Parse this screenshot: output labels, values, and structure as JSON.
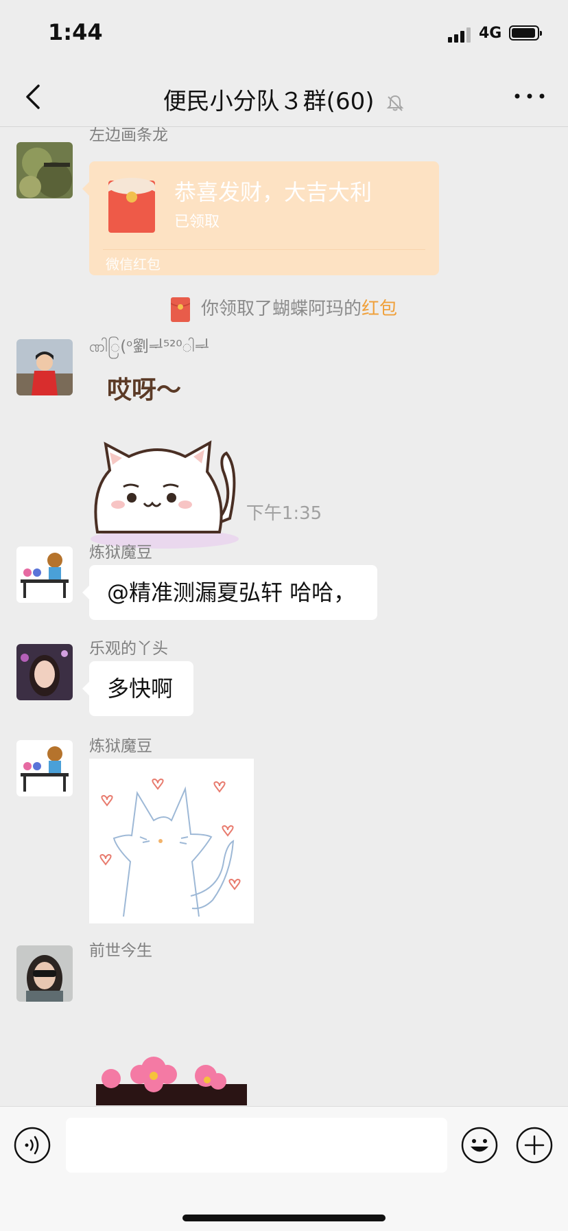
{
  "status_bar": {
    "time": "1:44",
    "network": "4G"
  },
  "nav": {
    "title": "便民小分队３群(60)",
    "back_icon": "chevron-left-icon",
    "mute_icon": "bell-off-icon",
    "more_icon": "more-dots-icon"
  },
  "messages": [
    {
      "sender": "左边画条龙",
      "type": "red_packet",
      "red_packet": {
        "title": "恭喜发财，大吉大利",
        "status": "已领取",
        "footer": "微信红包"
      }
    },
    {
      "type": "system",
      "prefix": "你领取了蝴蝶阿玛的",
      "highlight": "红包"
    },
    {
      "sender": "ဏါြ(ᵒ劉ᆗ⁵²⁰ါᆗ",
      "type": "sticker",
      "sticker_text": "哎呀～"
    },
    {
      "type": "time",
      "text": "下午1:35"
    },
    {
      "sender": "炼狱魔豆",
      "type": "text",
      "text": "@精准测漏夏弘轩 哈哈，"
    },
    {
      "sender": "乐观的丫头",
      "type": "text",
      "text": "多快啊"
    },
    {
      "sender": "炼狱魔豆",
      "type": "image"
    },
    {
      "sender": "前世今生",
      "type": "sticker"
    }
  ],
  "input_bar": {
    "placeholder": "",
    "voice_icon": "voice-icon",
    "emoji_icon": "emoji-icon",
    "plus_icon": "plus-icon"
  },
  "colors": {
    "background": "#ededed",
    "red_packet_bg": "#fde2c3",
    "highlight": "#f0a03a",
    "bubble": "#ffffff"
  }
}
